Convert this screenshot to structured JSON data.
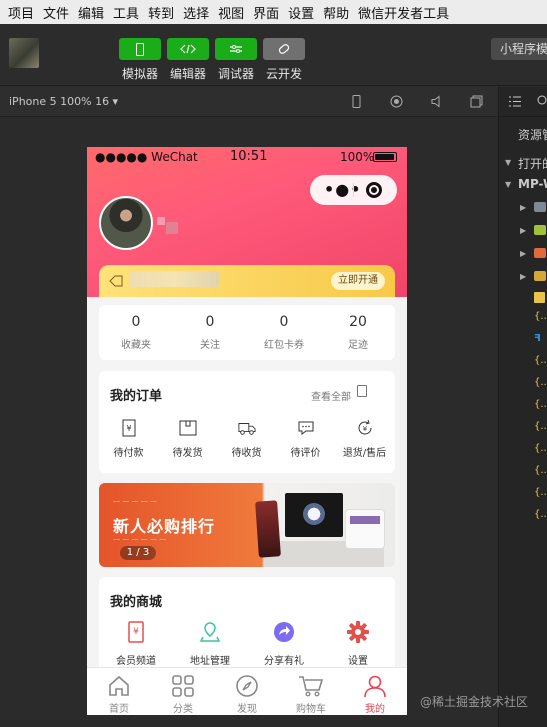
{
  "menu": [
    "项目",
    "文件",
    "编辑",
    "工具",
    "转到",
    "选择",
    "视图",
    "界面",
    "设置",
    "帮助",
    "微信开发者工具"
  ],
  "toolbar": {
    "buttons": [
      {
        "label": "模拟器",
        "icon": "phone-icon"
      },
      {
        "label": "编辑器",
        "icon": "code-icon"
      },
      {
        "label": "调试器",
        "icon": "debug-icon"
      },
      {
        "label": "云开发",
        "icon": "cloud-icon"
      }
    ],
    "mode": "小程序模式"
  },
  "simulator": {
    "device": "iPhone 5 100% 16 ▾"
  },
  "explorer": {
    "title": "资源管理器",
    "open_editors": "打开的编辑器",
    "project": "MP-WEIXIN",
    "files": [
      "JS",
      "{..}",
      "{..}",
      "{..}",
      "{..}",
      "{..}",
      "{..}",
      "{..}",
      "{..}",
      "{..}"
    ]
  },
  "phone": {
    "status": {
      "carrier": "●●●●● WeChat",
      "time": "10:51",
      "battery": "100%"
    },
    "vip": {
      "button": "立即开通"
    },
    "stats": [
      {
        "num": "0",
        "label": "收藏夹"
      },
      {
        "num": "0",
        "label": "关注"
      },
      {
        "num": "0",
        "label": "红包卡券"
      },
      {
        "num": "20",
        "label": "足迹"
      }
    ],
    "orders": {
      "title": "我的订单",
      "more": "查看全部",
      "items": [
        {
          "label": "待付款",
          "icon": "payment-icon"
        },
        {
          "label": "待发货",
          "icon": "box-icon"
        },
        {
          "label": "待收货",
          "icon": "truck-icon"
        },
        {
          "label": "待评价",
          "icon": "comment-icon"
        },
        {
          "label": "退货/售后",
          "icon": "refund-icon"
        }
      ]
    },
    "banner": {
      "title": "新人必购排行",
      "pager": "1 / 3"
    },
    "mall": {
      "title": "我的商城",
      "items": [
        {
          "label": "会员频道",
          "icon": "member-icon",
          "color": "#e0514b"
        },
        {
          "label": "地址管理",
          "icon": "location-icon",
          "color": "#3cc3a0"
        },
        {
          "label": "分享有礼",
          "icon": "share-icon",
          "color": "#7b6cf0"
        },
        {
          "label": "设置",
          "icon": "settings-icon",
          "color": "#e0514b"
        }
      ]
    },
    "tabs": [
      {
        "label": "首页",
        "icon": "home-icon"
      },
      {
        "label": "分类",
        "icon": "grid-icon"
      },
      {
        "label": "发现",
        "icon": "compass-icon"
      },
      {
        "label": "购物车",
        "icon": "cart-icon"
      },
      {
        "label": "我的",
        "icon": "user-icon"
      }
    ]
  },
  "watermark": "@稀土掘金技术社区"
}
